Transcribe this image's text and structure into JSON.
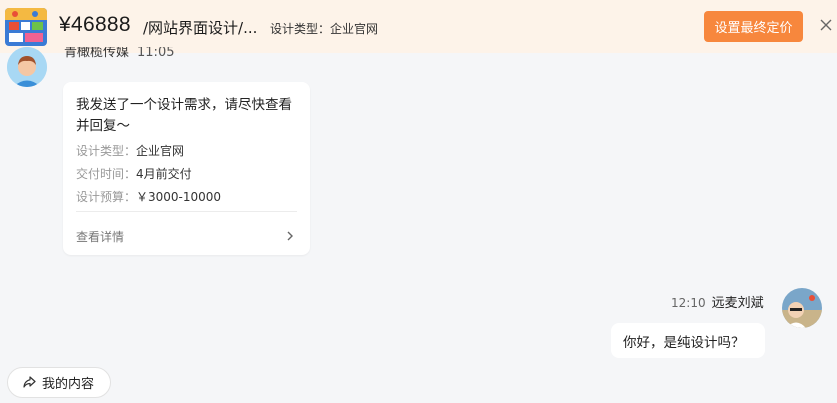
{
  "header": {
    "price": "¥46888",
    "project": "/网站界面设计/...",
    "design_type": "设计类型：企业官网",
    "set_price_label": "设置最终定价",
    "close_icon": "close-icon"
  },
  "sender": {
    "name": "青橄榄传媒",
    "time": "11:05"
  },
  "request_card": {
    "title": "我发送了一个设计需求，请尽快查看并回复～",
    "rows": [
      {
        "label": "设计类型：",
        "value": "企业官网"
      },
      {
        "label": "交付时间：",
        "value": "4月前交付"
      },
      {
        "label": "设计预算：",
        "value": "￥3000-10000"
      }
    ],
    "link_label": "查看详情",
    "link_icon": "chevron-right-icon"
  },
  "reply": {
    "time": "12:10",
    "name": "远麦刘斌",
    "message": "你好，是纯设计吗？"
  },
  "footer": {
    "my_content_label": "我的内容",
    "my_content_icon": "share-icon"
  },
  "colors": {
    "accent": "#f7873d",
    "banner_bg": "#fdf3e9",
    "page_bg": "#f5f6f8"
  }
}
